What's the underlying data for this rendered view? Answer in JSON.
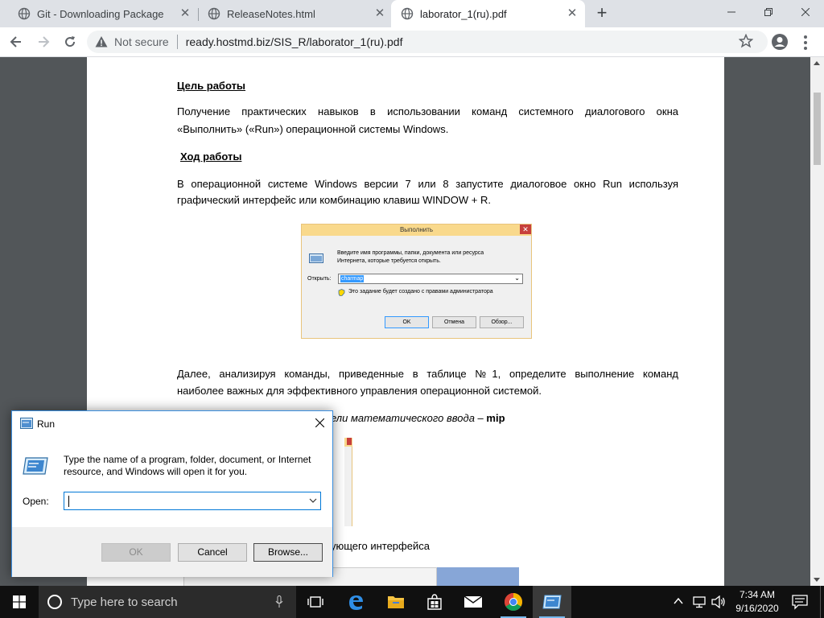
{
  "browser": {
    "tabs": [
      {
        "title": "Git - Downloading Package",
        "active": false
      },
      {
        "title": "ReleaseNotes.html",
        "active": false
      },
      {
        "title": "laborator_1(ru).pdf",
        "active": true
      }
    ],
    "security_label": "Not secure",
    "url": "ready.hostmd.biz/SIS_R/laborator_1(ru).pdf"
  },
  "document": {
    "goal_heading": "Цель работы",
    "goal_text_line1": "Получение практических навыков в использовании команд системного диалогового окна",
    "goal_text_line2": "«Выполнить» («Run») операционной системы Windows.",
    "progress_heading": "Ход работы",
    "progress_text_line1": "В операционной системе Windows  версии  7 или 8 запустите диалоговое окно Run используя",
    "progress_text_line2": "графический интерфейс или комбинацию клавиш WINDOW + R.",
    "next_text_line1": "Далее, анализируя команды, приведенные в таблице №1, определите выполнение команд",
    "next_text_line2": "наиболее важных для эффективного управления операционной системой.",
    "panel_text_prefix": "ели математического ввода – ",
    "panel_text_command": "mip",
    "interface_text": "ующего интерфейса"
  },
  "embedded_dialog": {
    "title": "Выполнить",
    "description": "Введите имя программы, папки, документа или ресурса Интернета, которые требуется открыть.",
    "open_label": "Открыть:",
    "value": "charmap",
    "admin_note": "Это задание будет создано с правами администратора",
    "ok": "OK",
    "cancel": "Отмена",
    "browse": "Обзор..."
  },
  "run_dialog": {
    "title": "Run",
    "description": "Type the name of a program, folder, document, or Internet resource, and Windows will open it for you.",
    "open_label": "Open:",
    "open_value": "",
    "ok_label": "OK",
    "cancel_label": "Cancel",
    "browse_label": "Browse..."
  },
  "taskbar": {
    "search_placeholder": "Type here to search",
    "time": "7:34 AM",
    "date": "9/16/2020"
  },
  "colors": {
    "accent": "#0078d7",
    "taskbar": "#101010",
    "pdf_background": "#525659"
  }
}
